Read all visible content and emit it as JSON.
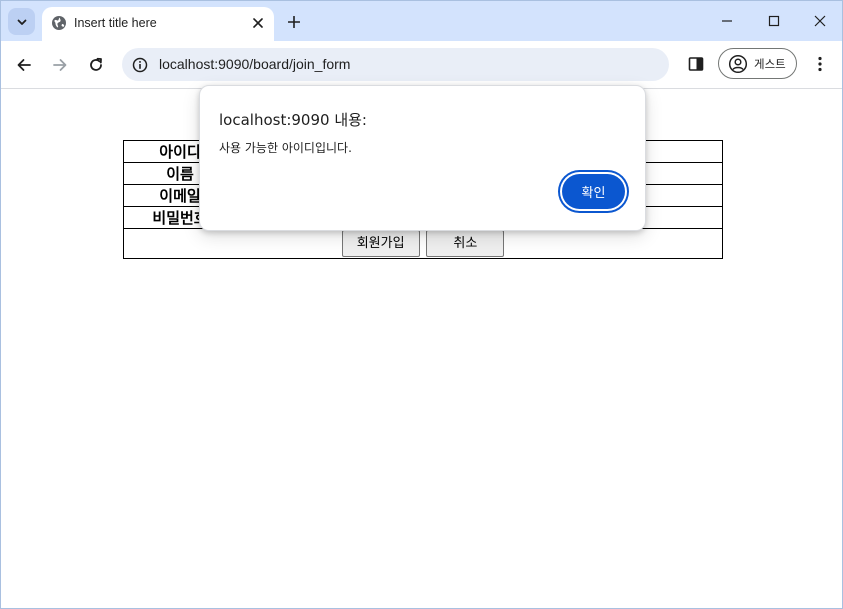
{
  "browser": {
    "tab": {
      "title": "Insert title here",
      "favicon": "globe-icon"
    },
    "address_bar": {
      "url": "localhost:9090/board/join_form"
    },
    "profile": {
      "label": "게스트"
    }
  },
  "form": {
    "rows": [
      {
        "label": "아이디"
      },
      {
        "label": "이름"
      },
      {
        "label": "이메일"
      },
      {
        "label": "비밀번호"
      }
    ],
    "submit_label": "회원가입",
    "cancel_label": "취소"
  },
  "dialog": {
    "title": "localhost:9090 내용:",
    "message": "사용 가능한 아이디입니다.",
    "ok_label": "확인"
  },
  "colors": {
    "tabstrip_bg": "#d3e3fd",
    "omnibox_bg": "#e9eef7",
    "accent": "#0b57d0"
  }
}
